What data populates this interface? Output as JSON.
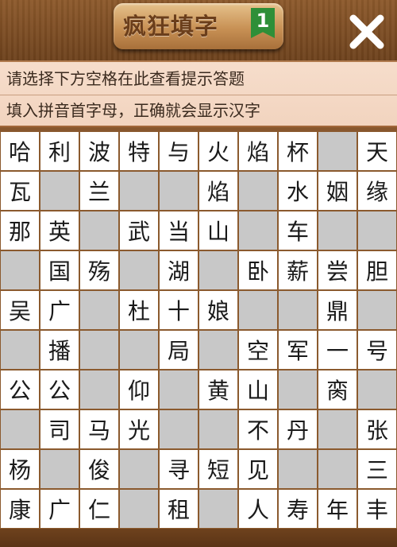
{
  "header": {
    "title": "疯狂填字",
    "level": "1",
    "close_icon": "close-x-icon"
  },
  "hints": {
    "line1": "请选择下方空格在此查看提示答题",
    "line2": "填入拼音首字母，正确就会显示汉字"
  },
  "grid": {
    "rows": 10,
    "cols": 10,
    "cells": [
      [
        "哈",
        "利",
        "波",
        "特",
        "与",
        "火",
        "焰",
        "杯",
        "",
        "天"
      ],
      [
        "瓦",
        "",
        "兰",
        "",
        "",
        "焰",
        "",
        "水",
        "姻",
        "缘"
      ],
      [
        "那",
        "英",
        "",
        "武",
        "当",
        "山",
        "",
        "车",
        "",
        ""
      ],
      [
        "",
        "国",
        "殇",
        "",
        "湖",
        "",
        "卧",
        "薪",
        "尝",
        "胆"
      ],
      [
        "吴",
        "广",
        "",
        "杜",
        "十",
        "娘",
        "",
        "",
        "鼎",
        ""
      ],
      [
        "",
        "播",
        "",
        "",
        "局",
        "",
        "空",
        "军",
        "一",
        "号"
      ],
      [
        "公",
        "公",
        "",
        "仰",
        "",
        "黄",
        "山",
        "",
        "脔",
        ""
      ],
      [
        "",
        "司",
        "马",
        "光",
        "",
        "",
        "不",
        "丹",
        "",
        "张"
      ],
      [
        "杨",
        "",
        "俊",
        "",
        "寻",
        "短",
        "见",
        "",
        "",
        "三"
      ],
      [
        "康",
        "广",
        "仁",
        "",
        "租",
        "",
        "人",
        "寿",
        "年",
        "丰"
      ]
    ],
    "filled_color": "#ffffff",
    "empty_color": "#c8c8c8",
    "line_color": "#8b5a2e"
  }
}
